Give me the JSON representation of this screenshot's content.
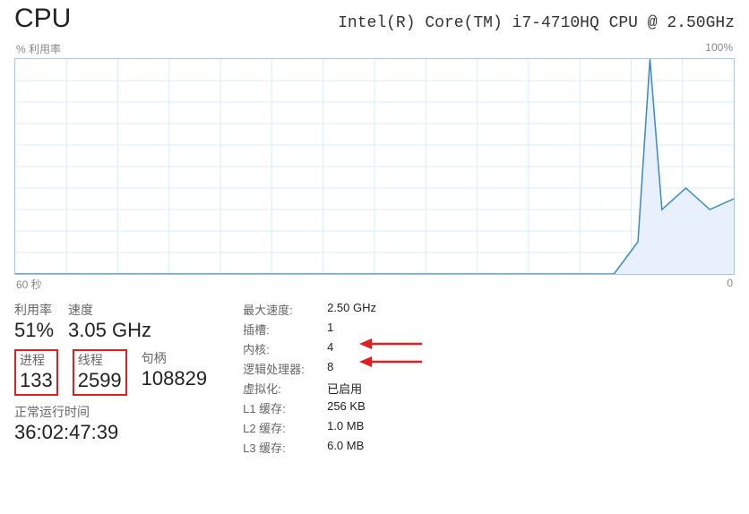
{
  "header": {
    "title": "CPU",
    "subtitle": "Intel(R) Core(TM) i7-4710HQ CPU @ 2.50GHz"
  },
  "chart": {
    "top_left_label": "% 利用率",
    "top_right_label": "100%",
    "bottom_left_label": "60 秒",
    "bottom_right_label": "0"
  },
  "stats": {
    "utilization": {
      "label": "利用率",
      "value": "51%"
    },
    "speed": {
      "label": "速度",
      "value": "3.05 GHz"
    },
    "processes": {
      "label": "进程",
      "value": "133"
    },
    "threads": {
      "label": "线程",
      "value": "2599"
    },
    "handles": {
      "label": "句柄",
      "value": "108829"
    },
    "uptime": {
      "label": "正常运行时间",
      "value": "36:02:47:39"
    }
  },
  "details": {
    "max_speed": {
      "label": "最大速度:",
      "value": "2.50 GHz"
    },
    "sockets": {
      "label": "插槽:",
      "value": "1"
    },
    "cores": {
      "label": "内核:",
      "value": "4"
    },
    "logical": {
      "label": "逻辑处理器:",
      "value": "8"
    },
    "virtualization": {
      "label": "虚拟化:",
      "value": "已启用"
    },
    "l1": {
      "label": "L1 缓存:",
      "value": "256 KB"
    },
    "l2": {
      "label": "L2 缓存:",
      "value": "1.0 MB"
    },
    "l3": {
      "label": "L3 缓存:",
      "value": "6.0 MB"
    }
  },
  "chart_data": {
    "type": "area",
    "title": "CPU % 利用率",
    "xlabel": "秒",
    "ylabel": "% 利用率",
    "xlim_label": [
      "60 秒",
      "0"
    ],
    "ylim": [
      0,
      100
    ],
    "x": [
      60,
      58,
      56,
      54,
      52,
      50,
      48,
      46,
      44,
      42,
      40,
      38,
      36,
      34,
      32,
      30,
      28,
      26,
      24,
      22,
      20,
      18,
      16,
      14,
      12,
      10,
      8,
      7,
      6,
      4,
      2,
      0
    ],
    "values": [
      0,
      0,
      0,
      0,
      0,
      0,
      0,
      0,
      0,
      0,
      0,
      0,
      0,
      0,
      0,
      0,
      0,
      0,
      0,
      0,
      0,
      0,
      0,
      0,
      0,
      0,
      15,
      100,
      30,
      40,
      30,
      35
    ]
  }
}
